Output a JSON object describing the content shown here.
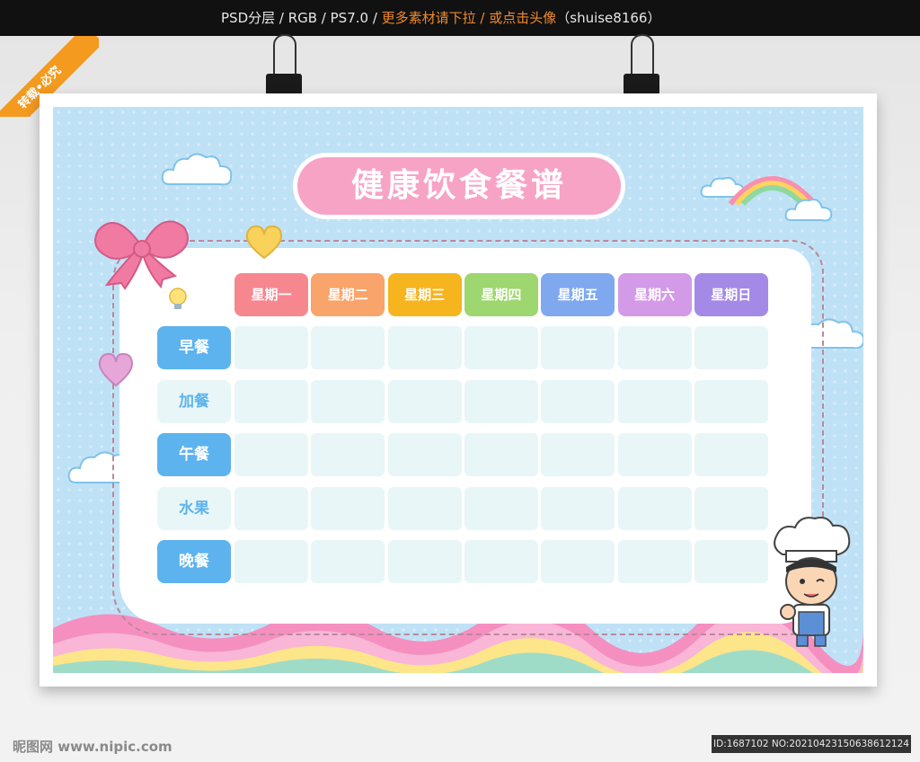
{
  "header": {
    "text_main": "PSD分层 / RGB / PS7.0 / ",
    "text_highlight": "更多素材请下拉 / 或点击头像",
    "text_tail": "（shuise8166）"
  },
  "corner_label": "转载•必究",
  "poster": {
    "title": "健康饮食餐谱",
    "days": [
      {
        "label": "星期一",
        "color": "#f7878f"
      },
      {
        "label": "星期二",
        "color": "#f9a46a"
      },
      {
        "label": "星期三",
        "color": "#f6b41e"
      },
      {
        "label": "星期四",
        "color": "#9ed66f"
      },
      {
        "label": "星期五",
        "color": "#7fa8ef"
      },
      {
        "label": "星期六",
        "color": "#d39be7"
      },
      {
        "label": "星期日",
        "color": "#a48ae6"
      }
    ],
    "meals": [
      {
        "label": "早餐",
        "style": "solid"
      },
      {
        "label": "加餐",
        "style": "pale"
      },
      {
        "label": "午餐",
        "style": "solid"
      },
      {
        "label": "水果",
        "style": "pale"
      },
      {
        "label": "晚餐",
        "style": "solid"
      }
    ]
  },
  "footer": {
    "logo": "昵图网 www.nipic.com",
    "id_text": "ID:1687102 NO:20210423150638612124"
  },
  "colors": {
    "sky": "#bfe1f6",
    "title_pink": "#f7a3c6",
    "meal_blue": "#5cb3ee",
    "cell_bg": "#e8f6f8"
  }
}
